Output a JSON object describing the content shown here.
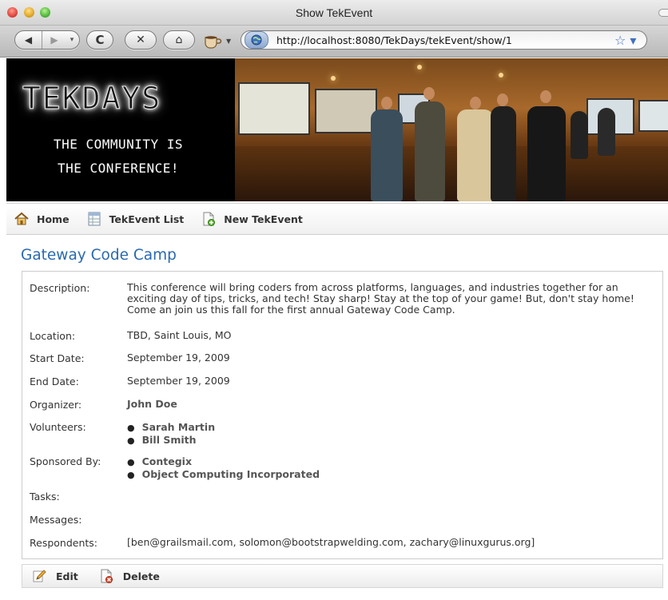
{
  "window": {
    "title": "Show TekEvent"
  },
  "browser": {
    "url": "http://localhost:8080/TekDays/tekEvent/show/1",
    "back_glyph": "◀",
    "forward_glyph": "▶",
    "dropdown_glyph": "▾",
    "reload_glyph": "C",
    "stop_glyph": "✕",
    "home_glyph": "⌂",
    "star_glyph": "☆ ▾"
  },
  "banner": {
    "logo": "TEKDAYS",
    "tagline_line1": "THE COMMUNITY IS",
    "tagline_line2": "THE CONFERENCE!"
  },
  "nav": {
    "home": "Home",
    "list": "TekEvent List",
    "new": "New TekEvent"
  },
  "event": {
    "title": "Gateway Code Camp",
    "rows": {
      "description": {
        "label": "Description:",
        "value": "This conference will bring coders from across platforms, languages, and industries together for an exciting day of tips, tricks, and tech! Stay sharp! Stay at the top of your game! But, don't stay home! Come an join us this fall for the first annual Gateway Code Camp."
      },
      "location": {
        "label": "Location:",
        "value": "TBD, Saint Louis, MO"
      },
      "start_date": {
        "label": "Start Date:",
        "value": "September 19, 2009"
      },
      "end_date": {
        "label": "End Date:",
        "value": "September 19, 2009"
      },
      "organizer": {
        "label": "Organizer:",
        "value": "John Doe"
      },
      "volunteers": {
        "label": "Volunteers:",
        "items": [
          "Sarah Martin",
          "Bill Smith"
        ]
      },
      "sponsored_by": {
        "label": "Sponsored By:",
        "items": [
          "Contegix",
          "Object Computing Incorporated"
        ]
      },
      "tasks": {
        "label": "Tasks:"
      },
      "messages": {
        "label": "Messages:"
      },
      "respondents": {
        "label": "Respondents:",
        "value": "[ben@grailsmail.com, solomon@bootstrapwelding.com, zachary@linuxgurus.org]"
      }
    }
  },
  "actions": {
    "edit": "Edit",
    "delete": "Delete"
  },
  "colors": {
    "title_blue": "#2a6aae",
    "banner_black": "#000000"
  }
}
